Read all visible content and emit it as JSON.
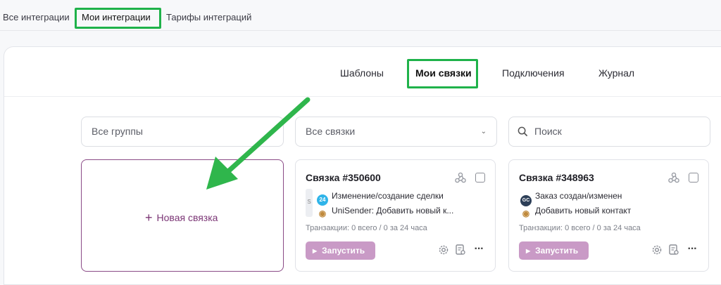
{
  "top_tabs": {
    "all": "Все интеграции",
    "mine": "Мои интеграции",
    "tariffs": "Тарифы интеграций"
  },
  "sub_tabs": {
    "templates": "Шаблоны",
    "my_links": "Мои связки",
    "connections": "Подключения",
    "journal": "Журнал"
  },
  "filters": {
    "groups": "Все группы",
    "links": "Все связки",
    "search_placeholder": "Поиск"
  },
  "new_link": {
    "label": "Новая связка"
  },
  "cards": [
    {
      "title": "Связка #350600",
      "steps": [
        {
          "icon": "bitrix24-icon",
          "text": "Изменение/создание сделки"
        },
        {
          "icon": "unisender-icon",
          "text": "UniSender: Добавить новый к..."
        }
      ],
      "side_label": "S",
      "transactions": "Транзакции: 0 всего / 0 за 24 часа",
      "run_label": "Запустить"
    },
    {
      "title": "Связка #348963",
      "steps": [
        {
          "icon": "getcourse-icon",
          "text": "Заказ создан/изменен"
        },
        {
          "icon": "unisender-icon",
          "text": "Добавить новый контакт"
        }
      ],
      "transactions": "Транзакции: 0 всего / 0 за 24 часа",
      "run_label": "Запустить"
    }
  ],
  "icon_text": {
    "bitrix24": "24",
    "getcourse": "GC"
  },
  "colors": {
    "accent": "#7b3575",
    "run_button": "#c99ac6",
    "highlight": "#1fb24a"
  }
}
